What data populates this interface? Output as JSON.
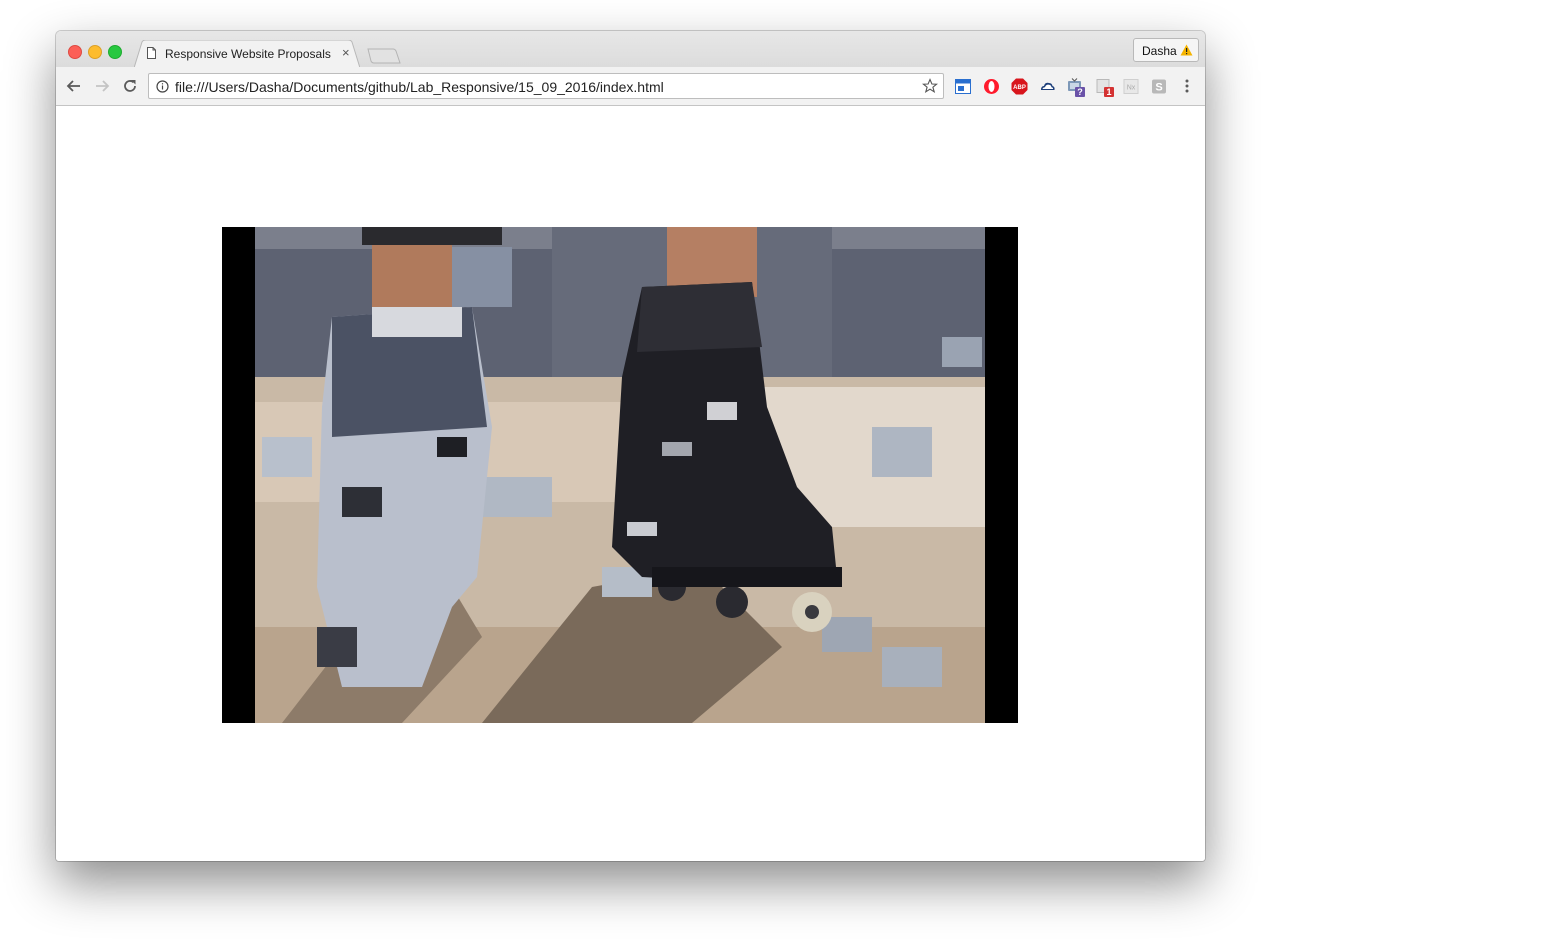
{
  "browser": {
    "tab": {
      "title": "Responsive Website Proposals",
      "close_glyph": "×"
    },
    "profile": {
      "name": "Dasha",
      "warning_icon": "warning-icon"
    },
    "toolbar": {
      "url": "file:///Users/Dasha/Documents/github/Lab_Responsive/15_09_2016/index.html",
      "extensions": [
        {
          "name": "tab-manager-extension-icon"
        },
        {
          "name": "opera-extension-icon"
        },
        {
          "name": "adblock-plus-extension-icon",
          "label": "ABP"
        },
        {
          "name": "cloud-extension-icon"
        },
        {
          "name": "tv-extension-icon",
          "badge": "?"
        },
        {
          "name": "notes-extension-icon",
          "badge": "1"
        },
        {
          "name": "nx-extension-icon",
          "label": "Nx"
        },
        {
          "name": "s-extension-icon",
          "label": "S"
        }
      ]
    }
  },
  "page": {
    "video": {
      "description_icon": "video-player"
    }
  },
  "colors": {
    "traffic_close": "#fc5f57",
    "traffic_minimize": "#fdbc2e",
    "traffic_maximize": "#28c840",
    "abp_red": "#d8151c",
    "opera_red": "#ff1b2d"
  }
}
